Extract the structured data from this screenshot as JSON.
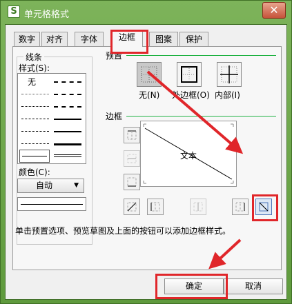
{
  "window": {
    "title": "单元格格式",
    "close_symbol": "✕"
  },
  "tabs": [
    {
      "label": "数字"
    },
    {
      "label": "对齐"
    },
    {
      "label": "字体"
    },
    {
      "label": "边框",
      "active": true
    },
    {
      "label": "图案"
    },
    {
      "label": "保护"
    }
  ],
  "line_group": {
    "title": "线条",
    "style_label": "样式(S):",
    "none_label": "无",
    "color_label": "颜色(C):",
    "color_value": "自动"
  },
  "presets": {
    "title": "预置",
    "items": [
      {
        "label": "无(N)"
      },
      {
        "label": "外边框(O)"
      },
      {
        "label": "内部(I)"
      }
    ]
  },
  "border": {
    "title": "边框",
    "preview_text": "文本"
  },
  "hint": "单击预置选项、预览草图及上面的按钮可以添加边框样式。",
  "buttons": {
    "ok": "确定",
    "cancel": "取消"
  },
  "colors": {
    "highlight_red": "#e0262a",
    "group_line_green": "#1cb140",
    "titlebar_green": "#6a9f45"
  }
}
